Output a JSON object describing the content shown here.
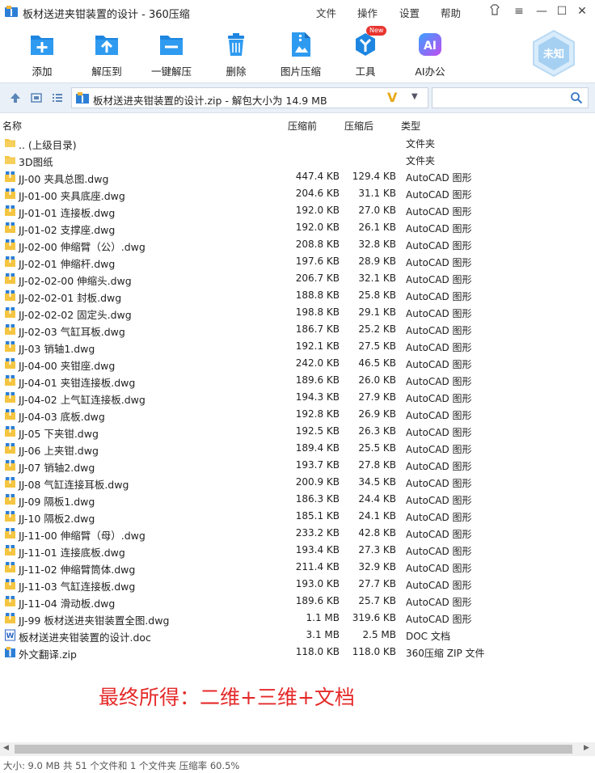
{
  "window": {
    "title": "板材送进夹钳装置的设计 - 360压缩"
  },
  "menu": {
    "file": "文件",
    "operate": "操作",
    "settings": "设置",
    "help": "帮助"
  },
  "toolbar": {
    "add": "添加",
    "extract_to": "解压到",
    "one_click": "一键解压",
    "delete": "删除",
    "image_compress": "图片压缩",
    "tools": "工具",
    "new_badge": "New",
    "ai_office": "AI办公"
  },
  "user": {
    "badge": "未知"
  },
  "address": {
    "path": "板材送进夹钳装置的设计.zip - 解包大小为 14.9 MB"
  },
  "columns": {
    "name": "名称",
    "compressed": "压缩前",
    "uncompressed": "压缩后",
    "type": "类型"
  },
  "files": [
    {
      "name": "..  (上级目录)",
      "a": "",
      "b": "",
      "type": "文件夹",
      "kind": "folder"
    },
    {
      "name": "3D图纸",
      "a": "",
      "b": "",
      "type": "文件夹",
      "kind": "folder"
    },
    {
      "name": "JJ-00 夹具总图.dwg",
      "a": "447.4 KB",
      "b": "129.4 KB",
      "type": "AutoCAD 图形",
      "kind": "dwg"
    },
    {
      "name": "JJ-01-00 夹具底座.dwg",
      "a": "204.6 KB",
      "b": "31.1 KB",
      "type": "AutoCAD 图形",
      "kind": "dwg"
    },
    {
      "name": "JJ-01-01 连接板.dwg",
      "a": "192.0 KB",
      "b": "27.0 KB",
      "type": "AutoCAD 图形",
      "kind": "dwg"
    },
    {
      "name": "JJ-01-02 支撑座.dwg",
      "a": "192.0 KB",
      "b": "26.1 KB",
      "type": "AutoCAD 图形",
      "kind": "dwg"
    },
    {
      "name": "JJ-02-00 伸缩臂（公）.dwg",
      "a": "208.8 KB",
      "b": "32.8 KB",
      "type": "AutoCAD 图形",
      "kind": "dwg"
    },
    {
      "name": "JJ-02-01 伸缩杆.dwg",
      "a": "197.6 KB",
      "b": "28.9 KB",
      "type": "AutoCAD 图形",
      "kind": "dwg"
    },
    {
      "name": "JJ-02-02-00 伸缩头.dwg",
      "a": "206.7 KB",
      "b": "32.1 KB",
      "type": "AutoCAD 图形",
      "kind": "dwg"
    },
    {
      "name": "JJ-02-02-01 封板.dwg",
      "a": "188.8 KB",
      "b": "25.8 KB",
      "type": "AutoCAD 图形",
      "kind": "dwg"
    },
    {
      "name": "JJ-02-02-02 固定头.dwg",
      "a": "198.8 KB",
      "b": "29.1 KB",
      "type": "AutoCAD 图形",
      "kind": "dwg"
    },
    {
      "name": "JJ-02-03 气缸耳板.dwg",
      "a": "186.7 KB",
      "b": "25.2 KB",
      "type": "AutoCAD 图形",
      "kind": "dwg"
    },
    {
      "name": "JJ-03 销轴1.dwg",
      "a": "192.1 KB",
      "b": "27.5 KB",
      "type": "AutoCAD 图形",
      "kind": "dwg"
    },
    {
      "name": "JJ-04-00 夹钳座.dwg",
      "a": "242.0 KB",
      "b": "46.5 KB",
      "type": "AutoCAD 图形",
      "kind": "dwg"
    },
    {
      "name": "JJ-04-01 夹钳连接板.dwg",
      "a": "189.6 KB",
      "b": "26.0 KB",
      "type": "AutoCAD 图形",
      "kind": "dwg"
    },
    {
      "name": "JJ-04-02 上气缸连接板.dwg",
      "a": "194.3 KB",
      "b": "27.9 KB",
      "type": "AutoCAD 图形",
      "kind": "dwg"
    },
    {
      "name": "JJ-04-03 底板.dwg",
      "a": "192.8 KB",
      "b": "26.9 KB",
      "type": "AutoCAD 图形",
      "kind": "dwg"
    },
    {
      "name": "JJ-05 下夹钳.dwg",
      "a": "192.5 KB",
      "b": "26.3 KB",
      "type": "AutoCAD 图形",
      "kind": "dwg"
    },
    {
      "name": "JJ-06 上夹钳.dwg",
      "a": "189.4 KB",
      "b": "25.5 KB",
      "type": "AutoCAD 图形",
      "kind": "dwg"
    },
    {
      "name": "JJ-07 销轴2.dwg",
      "a": "193.7 KB",
      "b": "27.8 KB",
      "type": "AutoCAD 图形",
      "kind": "dwg"
    },
    {
      "name": "JJ-08 气缸连接耳板.dwg",
      "a": "200.9 KB",
      "b": "34.5 KB",
      "type": "AutoCAD 图形",
      "kind": "dwg"
    },
    {
      "name": "JJ-09 隔板1.dwg",
      "a": "186.3 KB",
      "b": "24.4 KB",
      "type": "AutoCAD 图形",
      "kind": "dwg"
    },
    {
      "name": "JJ-10 隔板2.dwg",
      "a": "185.1 KB",
      "b": "24.1 KB",
      "type": "AutoCAD 图形",
      "kind": "dwg"
    },
    {
      "name": "JJ-11-00 伸缩臂（母）.dwg",
      "a": "233.2 KB",
      "b": "42.8 KB",
      "type": "AutoCAD 图形",
      "kind": "dwg"
    },
    {
      "name": "JJ-11-01 连接底板.dwg",
      "a": "193.4 KB",
      "b": "27.3 KB",
      "type": "AutoCAD 图形",
      "kind": "dwg"
    },
    {
      "name": "JJ-11-02 伸缩臂筒体.dwg",
      "a": "211.4 KB",
      "b": "32.9 KB",
      "type": "AutoCAD 图形",
      "kind": "dwg"
    },
    {
      "name": "JJ-11-03 气缸连接板.dwg",
      "a": "193.0 KB",
      "b": "27.7 KB",
      "type": "AutoCAD 图形",
      "kind": "dwg"
    },
    {
      "name": "JJ-11-04 滑动板.dwg",
      "a": "189.6 KB",
      "b": "25.7 KB",
      "type": "AutoCAD 图形",
      "kind": "dwg"
    },
    {
      "name": "JJ-99 板材送进夹钳装置全图.dwg",
      "a": "1.1 MB",
      "b": "319.6 KB",
      "type": "AutoCAD 图形",
      "kind": "dwg"
    },
    {
      "name": "板材送进夹钳装置的设计.doc",
      "a": "3.1 MB",
      "b": "2.5 MB",
      "type": "DOC 文档",
      "kind": "doc"
    },
    {
      "name": "外文翻译.zip",
      "a": "118.0 KB",
      "b": "118.0 KB",
      "type": "360压缩 ZIP 文件",
      "kind": "zip"
    }
  ],
  "note": "最终所得：二维+三维+文档",
  "status": "大小: 9.0 MB 共 51 个文件和 1 个文件夹 压缩率 60.5%",
  "colors": {
    "accent": "#1e7fd8",
    "note": "#e52a2a",
    "folder": "#f5c542"
  }
}
